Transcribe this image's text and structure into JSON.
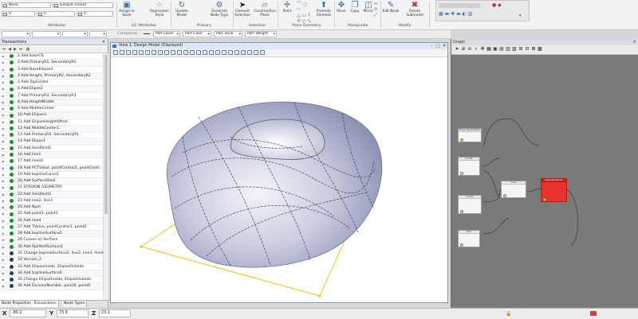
{
  "ribbon": {
    "field_level": "None",
    "field_template": "Default (none)",
    "field_weight": "0",
    "field_style": "0",
    "field_scale": "0",
    "attributes_label": "Attributes",
    "buttons": [
      {
        "label": "Assign to Node",
        "icon": "assign-node-icon"
      },
      {
        "label": "Replication Style",
        "icon": "replication-icon"
      },
      {
        "label": "Update Model",
        "icon": "update-icon"
      },
      {
        "label": "Generate Node Type",
        "icon": "generate-icon"
      },
      {
        "label": "Element Selection",
        "icon": "cursor-icon"
      },
      {
        "label": "Construction Plane",
        "icon": "plane-icon"
      },
      {
        "label": "Point",
        "icon": "point-icon"
      },
      {
        "label": "Promote Element",
        "icon": "promote-icon"
      },
      {
        "label": "Move",
        "icon": "move-icon"
      },
      {
        "label": "Copy",
        "icon": "copy-icon"
      },
      {
        "label": "Mirror",
        "icon": "mirror-icon"
      },
      {
        "label": "Edit Node",
        "icon": "edit-icon"
      },
      {
        "label": "Delete Submodel",
        "icon": "delete-icon"
      }
    ],
    "groups": {
      "gc_attributes": "GC Attributes",
      "primary": "Primary",
      "selection": "Selection",
      "place_geometry": "Place Geometry",
      "manipulate": "Manipulate",
      "modify": "Modify"
    }
  },
  "toolbar2": {
    "compound": "Compound",
    "part_level": "Part Level",
    "part_color": "Part Color",
    "part_style": "Part Style",
    "part_weight": "Part Weight"
  },
  "transactions": {
    "title": "Transactions",
    "items": [
      "1 Add baseCS",
      "2 Add PrimaryR1, SecondaryR1",
      "3 Add BaseEllipse1",
      "4 Add Height, PrimaryR2, SecondaryR2",
      "5 Add TopCenter",
      "6 Add Elipse2",
      "7 Add PrimaryR3, SecondaryR3",
      "8 Add HeightMiddle",
      "9 Add MiddleCenter",
      "10 Add Ellipse3",
      "11 Add EllipseHeightOffset",
      "12 Add MiddleCenter1",
      "13 Add PrimaryR4, SecondaryR4",
      "14 Add Elipse1",
      "15 Add AxisPoint1",
      "16 Add line1",
      "17 Add lines0",
      "18 Add PCTValue, pointControl1, pointContr",
      "19 Add bsplineCurve2",
      "20 Add SurfaceShell",
      "21 STADION GEOMETRY",
      "22 Add AxisPoint1",
      "23 Add line2, line3",
      "24 Add Num",
      "25 Add point1, point2",
      "26 Add line4",
      "27 Add TValue, pointControl1, point2",
      "28 Add bsplineSurface2",
      "29 Curves on Surface",
      "30 Add SplittedSurface1",
      "31 Change bsplineSurface2, line2, line3, line4",
      "32 Version_2",
      "33 Add Ellipseinside, EllipseOutside",
      "34 Add bsplineSurface6",
      "35 Change EllipseInside, EllipseOutside",
      "36 Add DivisionNumber, point4, point6"
    ],
    "tabs": [
      "Node Properties",
      "Transactions",
      "Node Types"
    ]
  },
  "view": {
    "title": "View 1, Design Model (Displayed)",
    "surface_color": "#c9cbe0",
    "frame_color": "#e8c21a"
  },
  "graph": {
    "title": "Graph",
    "nodes": [
      {
        "title": "EllipseHeightOffset",
        "color": "#f4f4f4"
      },
      {
        "title": "point6",
        "color": "#f4f4f4"
      },
      {
        "title": "point4",
        "color": "#f4f4f4"
      },
      {
        "title": "line5",
        "color": "#f4f4f4"
      },
      {
        "title": "Num",
        "color": "#f4f4f4"
      },
      {
        "title": "bsplineSurface7",
        "color": "#e8312b"
      }
    ]
  },
  "status": {
    "x_label": "X",
    "x_value": "-80.2",
    "y_label": "Y",
    "y_value": "73.9",
    "z_label": "Z",
    "z_value": "23.1"
  }
}
